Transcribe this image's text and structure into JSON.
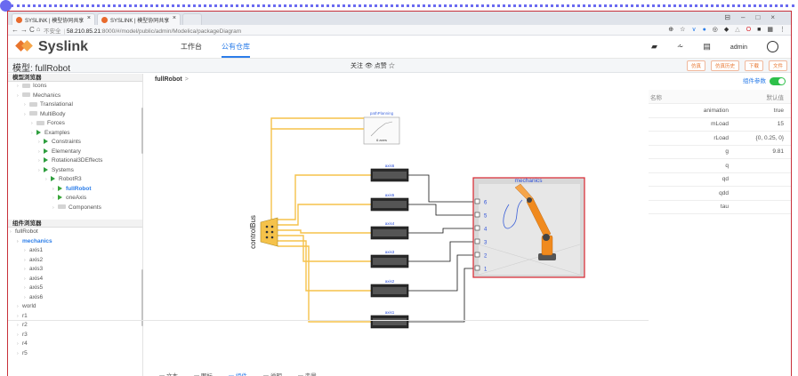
{
  "browser": {
    "tabs": [
      {
        "label": "SYSLINK | 模型协同共享"
      },
      {
        "label": "SYSLINK | 模型协同共享"
      }
    ],
    "url_insecure": "不安全",
    "url_host": "58.210.85.21",
    "url_path": ":8000/#/model/public/admin/Modelica/packageDiagram"
  },
  "app": {
    "brand": "Syslink",
    "nav": [
      {
        "label": "工作台"
      },
      {
        "label": "公有仓库"
      }
    ],
    "user": "admin"
  },
  "model": {
    "title": "模型: fullRobot",
    "follow": "关注",
    "like": "点赞",
    "buttons": [
      {
        "label": "仿真"
      },
      {
        "label": "仿真历史"
      },
      {
        "label": "下载"
      },
      {
        "label": "文件"
      }
    ]
  },
  "model_browser": {
    "title": "模型浏览器",
    "items": [
      {
        "label": "Icons",
        "depth": 1,
        "icon": "folder"
      },
      {
        "label": "Mechanics",
        "depth": 1,
        "icon": "folder"
      },
      {
        "label": "Translational",
        "depth": 2,
        "icon": "folder"
      },
      {
        "label": "MultiBody",
        "depth": 2,
        "icon": "folder"
      },
      {
        "label": "Forces",
        "depth": 3,
        "icon": "folder"
      },
      {
        "label": "Examples",
        "depth": 3,
        "icon": "package"
      },
      {
        "label": "Constraints",
        "depth": 4,
        "icon": "package"
      },
      {
        "label": "Elementary",
        "depth": 4,
        "icon": "package"
      },
      {
        "label": "Rotational3DEffects",
        "depth": 4,
        "icon": "package"
      },
      {
        "label": "Systems",
        "depth": 4,
        "icon": "package"
      },
      {
        "label": "RobotR3",
        "depth": 5,
        "icon": "package"
      },
      {
        "label": "fullRobot",
        "depth": 6,
        "icon": "play",
        "selected": true
      },
      {
        "label": "oneAxis",
        "depth": 6,
        "icon": "play"
      },
      {
        "label": "Components",
        "depth": 6,
        "icon": "folder"
      }
    ]
  },
  "component_browser": {
    "title": "组件浏览器",
    "items": [
      {
        "label": "fullRobot",
        "depth": 0
      },
      {
        "label": "mechanics",
        "depth": 1,
        "selected": true
      },
      {
        "label": "axis1",
        "depth": 2
      },
      {
        "label": "axis2",
        "depth": 2
      },
      {
        "label": "axis3",
        "depth": 2
      },
      {
        "label": "axis4",
        "depth": 2
      },
      {
        "label": "axis5",
        "depth": 2
      },
      {
        "label": "axis6",
        "depth": 2
      },
      {
        "label": "world",
        "depth": 1
      },
      {
        "label": "r1",
        "depth": 1
      },
      {
        "label": "r2",
        "depth": 1
      },
      {
        "label": "r3",
        "depth": 1
      },
      {
        "label": "r4",
        "depth": 1
      },
      {
        "label": "r5",
        "depth": 1
      }
    ]
  },
  "diagram": {
    "breadcrumb": "fullRobot",
    "path_planning": {
      "label": "pathPlanning",
      "sublabel": "6 axes"
    },
    "axes": [
      "axis6",
      "axis5",
      "axis4",
      "axis3",
      "axis2",
      "axis1"
    ],
    "bus_label": "controlBus",
    "mechanics_label": "mechanics",
    "port_numbers": [
      "6",
      "5",
      "4",
      "3",
      "2",
      "1"
    ],
    "bus_color": "#f5c24a",
    "mechanics_border_color": "#d8262e",
    "robot_color": "#f08a1e"
  },
  "bottom_tabs": [
    {
      "label": "文本",
      "icon": "doc-icon"
    },
    {
      "label": "图标",
      "icon": "image-icon"
    },
    {
      "label": "组件",
      "icon": "component-icon",
      "active": true
    },
    {
      "label": "说明",
      "icon": "info-icon"
    },
    {
      "label": "变量",
      "icon": "variable-icon"
    }
  ],
  "parameters": {
    "toggle_label": "组件参数",
    "col_name": "名称",
    "col_default": "默认值",
    "rows": [
      {
        "name": "animation",
        "value": "true"
      },
      {
        "name": "mLoad",
        "value": "15"
      },
      {
        "name": "rLoad",
        "value": "{0, 0.25, 0}"
      },
      {
        "name": "g",
        "value": "9.81"
      },
      {
        "name": "q",
        "value": ""
      },
      {
        "name": "qd",
        "value": ""
      },
      {
        "name": "qdd",
        "value": ""
      },
      {
        "name": "tau",
        "value": ""
      }
    ]
  }
}
